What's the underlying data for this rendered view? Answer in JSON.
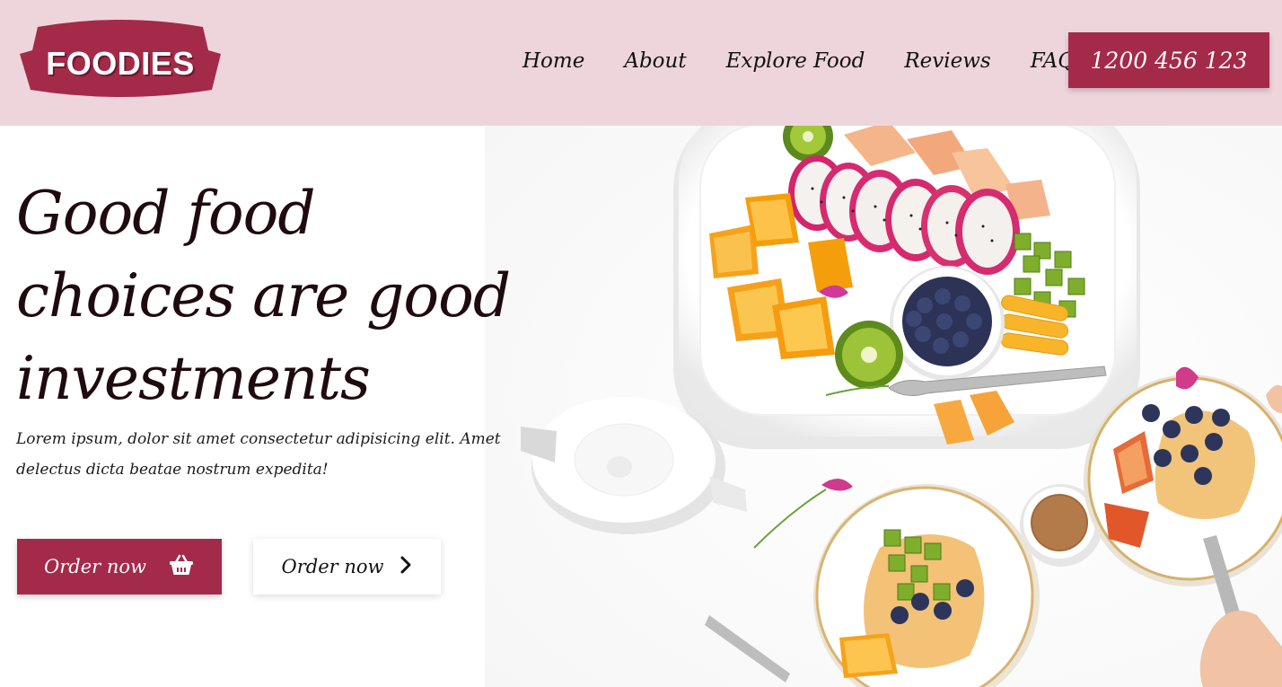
{
  "brand": {
    "logo_text": "FOODIES",
    "accent_color": "#a42a49",
    "header_bg": "#eed5dc"
  },
  "nav": {
    "items": [
      {
        "label": "Home"
      },
      {
        "label": "About"
      },
      {
        "label": "Explore Food"
      },
      {
        "label": "Reviews"
      },
      {
        "label": "FAQ"
      }
    ],
    "phone": "1200 456 123"
  },
  "hero": {
    "headline": "Good food choices are good investments",
    "description": "Lorem ipsum, dolor sit amet consectetur adipisicing elit. Amet delectus dicta beatae nostrum expedita!",
    "primary_button": {
      "label": "Order now",
      "icon": "basket-icon"
    },
    "secondary_button": {
      "label": "Order now",
      "icon": "chevron-right-icon"
    }
  }
}
